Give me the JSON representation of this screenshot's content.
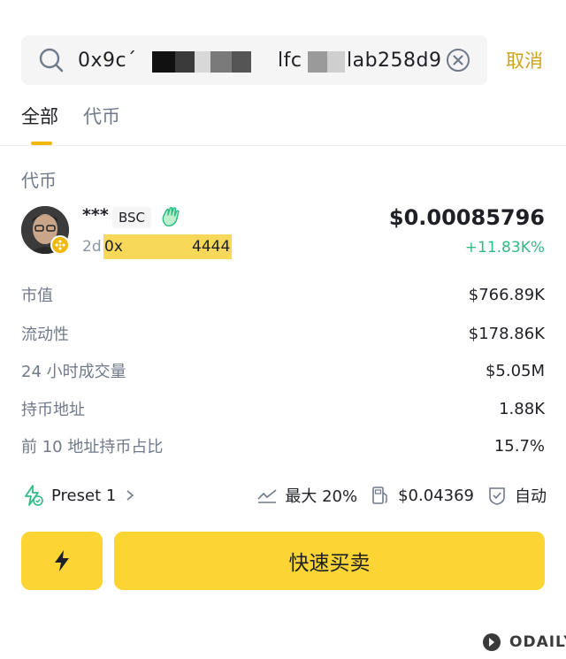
{
  "search": {
    "value_prefix": "0x9c´",
    "value_mid": "h",
    "value_mid2": "lfc",
    "value_suffix": "lab258d9",
    "cancel_label": "取消"
  },
  "tabs": [
    {
      "label": "全部",
      "active": true
    },
    {
      "label": "代币",
      "active": false
    }
  ],
  "section_title": "代币",
  "token": {
    "name": "***",
    "chain": "BSC",
    "age": "2d",
    "address_prefix": "0x",
    "address_suffix": "4444",
    "price": "$0.00085796",
    "change": "+11.83K%"
  },
  "stats": [
    {
      "label": "市值",
      "value": "$766.89K"
    },
    {
      "label": "流动性",
      "value": "$178.86K"
    },
    {
      "label": "24 小时成交量",
      "value": "$5.05M"
    },
    {
      "label": "持币地址",
      "value": "1.88K"
    },
    {
      "label": "前 10 地址持币占比",
      "value": "15.7%"
    }
  ],
  "preset": {
    "label": "Preset 1",
    "slippage": "最大 20%",
    "gas": "$0.04369",
    "mode": "自动"
  },
  "trade_button_label": "快速买卖",
  "watermark": "ODAILY",
  "colors": {
    "accent": "#fcd535",
    "cancel": "#d0a21c",
    "positive": "#2ebd85"
  }
}
